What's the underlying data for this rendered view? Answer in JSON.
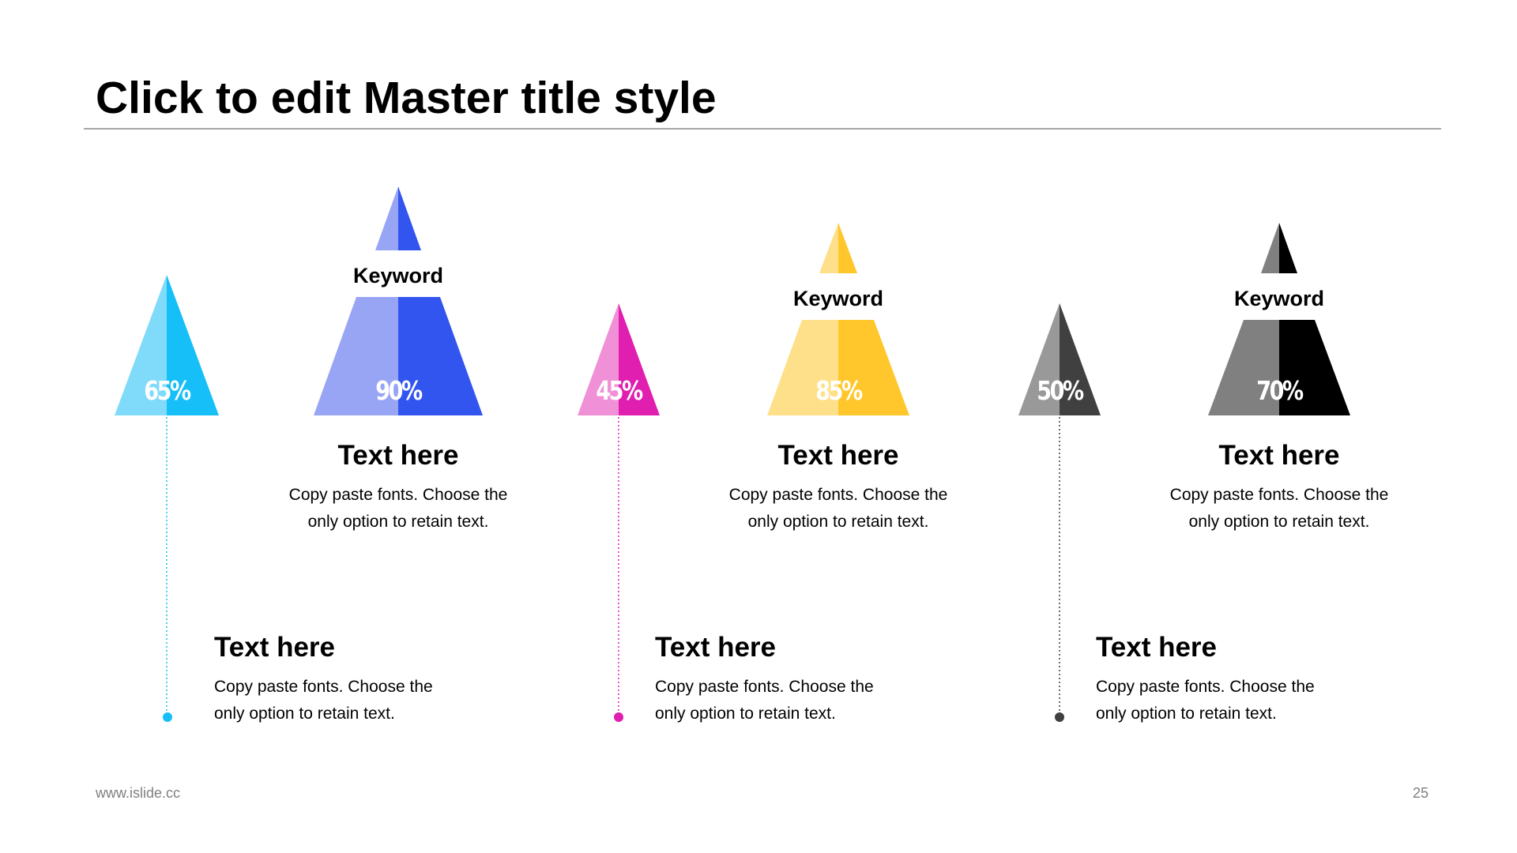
{
  "title": "Click to edit Master title style",
  "footer": {
    "url": "www.islide.cc",
    "page": "25"
  },
  "colors": {
    "blue_light": "#80dafa",
    "blue": "#16bff8",
    "indigo_light": "#98a5f4",
    "indigo": "#3355ef",
    "magenta_light": "#f090d6",
    "magenta": "#e01eb0",
    "yellow_light": "#ffe08a",
    "yellow": "#ffc72b",
    "gray_light": "#999999",
    "gray_dark": "#404040",
    "gray_mid": "#808080",
    "black": "#000000"
  },
  "lower_items": [
    {
      "percent": "65%",
      "value": 65,
      "color": "blue",
      "title": "Text here",
      "desc_line1": "Copy paste fonts. Choose the",
      "desc_line2": "only option to retain text."
    },
    {
      "percent": "45%",
      "value": 45,
      "color": "magenta",
      "title": "Text here",
      "desc_line1": "Copy paste fonts. Choose the",
      "desc_line2": "only option to retain text."
    },
    {
      "percent": "50%",
      "value": 50,
      "color": "gray",
      "title": "Text here",
      "desc_line1": "Copy paste fonts. Choose the",
      "desc_line2": "only option to retain text."
    }
  ],
  "upper_items": [
    {
      "percent": "90%",
      "value": 90,
      "color": "indigo",
      "keyword": "Keyword",
      "title": "Text here",
      "desc_line1": "Copy paste fonts. Choose the",
      "desc_line2": "only option to retain text."
    },
    {
      "percent": "85%",
      "value": 85,
      "color": "yellow",
      "keyword": "Keyword",
      "title": "Text here",
      "desc_line1": "Copy paste fonts. Choose the",
      "desc_line2": "only option to retain text."
    },
    {
      "percent": "70%",
      "value": 70,
      "color": "black",
      "keyword": "Keyword",
      "title": "Text here",
      "desc_line1": "Copy paste fonts. Choose the",
      "desc_line2": "only option to retain text."
    }
  ]
}
